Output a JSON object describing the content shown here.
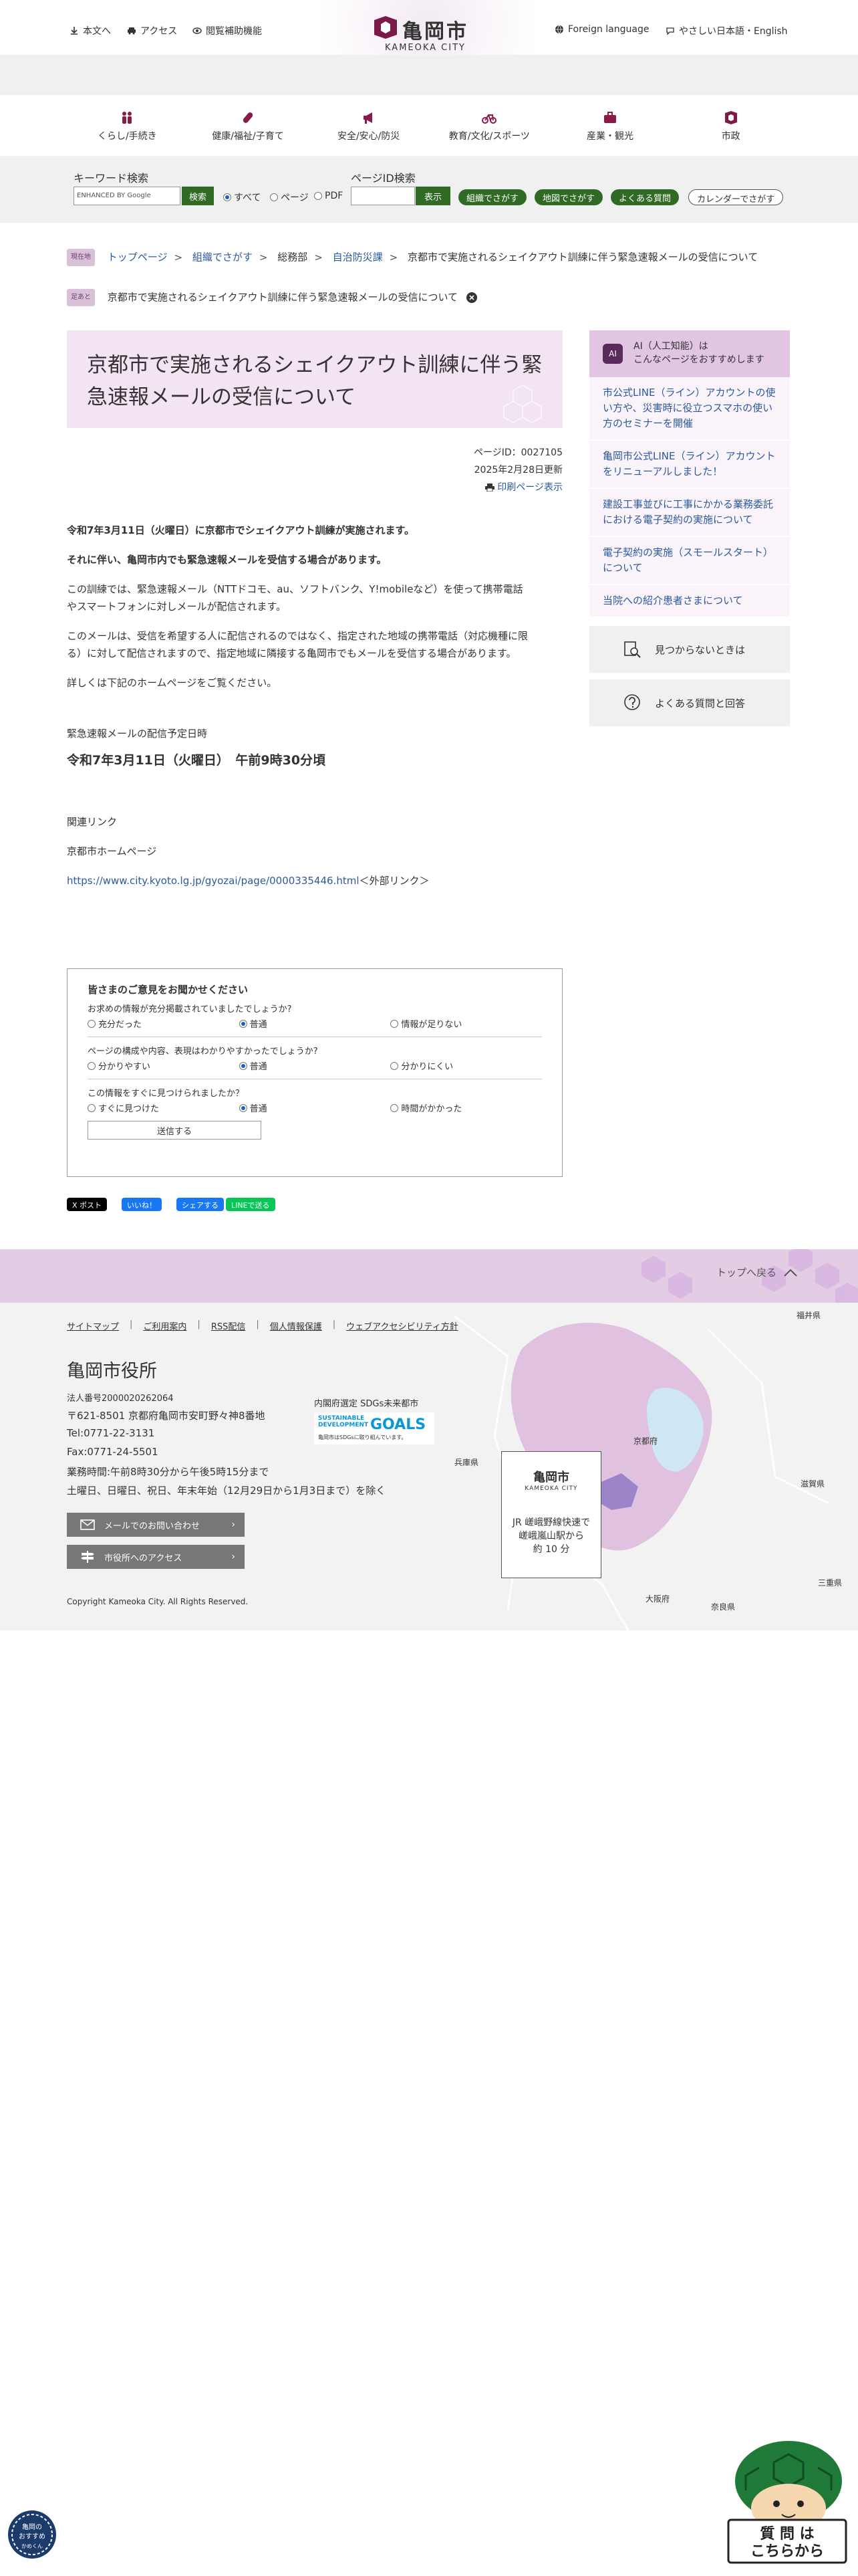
{
  "header": {
    "links": [
      "本文へ",
      "アクセス",
      "閲覧補助機能"
    ],
    "logo_text": "亀岡市",
    "logo_en": "KAMEOKA CITY",
    "lang_links": [
      "Foreign language",
      "やさしい日本語・English"
    ]
  },
  "gnav": [
    "くらし/手続き",
    "健康/福祉/子育て",
    "安全/安心/防災",
    "教育/文化/スポーツ",
    "産業・観光",
    "市政"
  ],
  "search": {
    "kw_label": "キーワード検索",
    "kw_placeholder": "ENHANCED BY Google",
    "kw_button": "検索",
    "radio": [
      "すべて",
      "ページ",
      "PDF"
    ],
    "pid_label": "ページID検索",
    "pid_button": "表示",
    "quick": [
      "組織でさがす",
      "地図でさがす",
      "よくある質問",
      "カレンダーでさがす"
    ]
  },
  "breadcrumb": {
    "tag1": "現在地",
    "items": [
      "トップページ",
      "組織でさがす",
      "総務部",
      "自治防災課",
      "京都市で実施されるシェイクアウト訓練に伴う緊急速報メールの受信について"
    ],
    "tag2": "足あと",
    "history": "京都市で実施されるシェイクアウト訓練に伴う緊急速報メールの受信について"
  },
  "article": {
    "title": "京都市で実施されるシェイクアウト訓練に伴う緊急速報メールの受信について",
    "page_id": "ページID：0027105",
    "updated": "2025年2月28日更新",
    "print": "印刷ページ表示",
    "p1": "令和7年3月11日（火曜日）に京都市でシェイクアウト訓練が実施されます。",
    "p2": "それに伴い、亀岡市内でも緊急速報メールを受信する場合があります。",
    "p3a": "この訓練では、緊急速報メール（NTTドコモ、au、ソフトバンク、Y!mobileなど）を使って携帯電話",
    "p3b": "やスマートフォンに対しメールが配信されます。",
    "p4a": "このメールは、受信を希望する人に配信されるのではなく、指定された地域の携帯電話（対応機種に限",
    "p4b": "る）に対して配信されますので、指定地域に隣接する亀岡市でもメールを受信する場合があります。",
    "p5": "詳しくは下記のホームページをご覧ください。",
    "sched_label": "緊急速報メールの配信予定日時",
    "sched": "令和7年3月11日（火曜日）　午前9時30分頃",
    "related": "関連リンク",
    "related_name": "京都市ホームページ",
    "related_url": "https://www.city.kyoto.lg.jp/gyozai/page/0000335446.html",
    "external": "＜外部リンク＞"
  },
  "survey": {
    "title": "皆さまのご意見をお聞かせください",
    "q1": "お求めの情報が充分掲載されていましたでしょうか?",
    "q1_opts": [
      "充分だった",
      "普通",
      "情報が足りない"
    ],
    "q2": "ページの構成や内容、表現はわかりやすかったでしょうか?",
    "q2_opts": [
      "分かりやすい",
      "普通",
      "分かりにくい"
    ],
    "q3": "この情報をすぐに見つけられましたか？",
    "q3_opts": [
      "すぐに見つけた",
      "普通",
      "時間がかかった"
    ],
    "send": "送信する"
  },
  "share": [
    "X ポスト",
    "いいね！",
    "シェアする",
    "LINEで送る"
  ],
  "sidebar": {
    "ai_badge": "AI",
    "ai_title1": "AI（人工知能）は",
    "ai_title2": "こんなページをおすすめします",
    "links": [
      "市公式LINE（ライン）アカウントの使い方や、災害時に役立つスマホの使い方のセミナーを開催",
      "亀岡市公式LINE（ライン）アカウントをリニューアルしました！",
      "建設工事並びに工事にかかる業務委託における電子契約の実施について",
      "電子契約の実施（スモールスタート）について",
      "当院への紹介患者さまについて"
    ],
    "not_found": "見つからないときは",
    "faq": "よくある質問と回答"
  },
  "footer": {
    "back_top": "トップへ戻る",
    "links": [
      "サイトマップ",
      "ご利用案内",
      "RSS配信",
      "個人情報保護",
      "ウェブアクセシビリティ方針"
    ],
    "org": "亀岡市役所",
    "corp_no": "法人番号2000020262064",
    "address": "〒621-8501 京都府亀岡市安町野々神8番地",
    "tel": "Tel:0771-22-3131",
    "fax": "Fax:0771-24-5501",
    "hours": "業務時間:午前8時30分から午後5時15分まで",
    "closed": "土曜日、日曜日、祝日、年末年始（12月29日から1月3日まで）を除く",
    "btn_mail": "メールでのお問い合わせ",
    "btn_access": "市役所へのアクセス",
    "sdgs_label": "内閣府選定 SDGs未来都市",
    "sdgs_t1a": "SUSTAINABLE",
    "sdgs_t1b": "DEVELOPMENT",
    "sdgs_goals": "GOALS",
    "sdgs_t3": "亀岡市はSDGsに取り組んでいます。",
    "copyright": "Copyright Kameoka City. All Rights Reserved.",
    "map_labels": [
      "福井県",
      "京都府",
      "滋賀県",
      "兵庫県",
      "三重県",
      "大阪府",
      "奈良県"
    ],
    "map_logo": "亀岡市",
    "map_logo_en": "KAMEOKA CITY",
    "map_access1": "JR 嵯峨野線快速で",
    "map_access2": "嵯峨嵐山駅から",
    "map_access3": "約 10 分"
  },
  "mascot": {
    "left_text1": "亀岡の",
    "left_text2": "おすすめ",
    "left_text3": "かめくん",
    "right_text1": "質 問 は",
    "right_text2": "こちらから"
  },
  "colors": {
    "accent_green": "#2f6b24",
    "accent_purple": "#5a2a5a",
    "title_bg": "#f3e4f3"
  }
}
